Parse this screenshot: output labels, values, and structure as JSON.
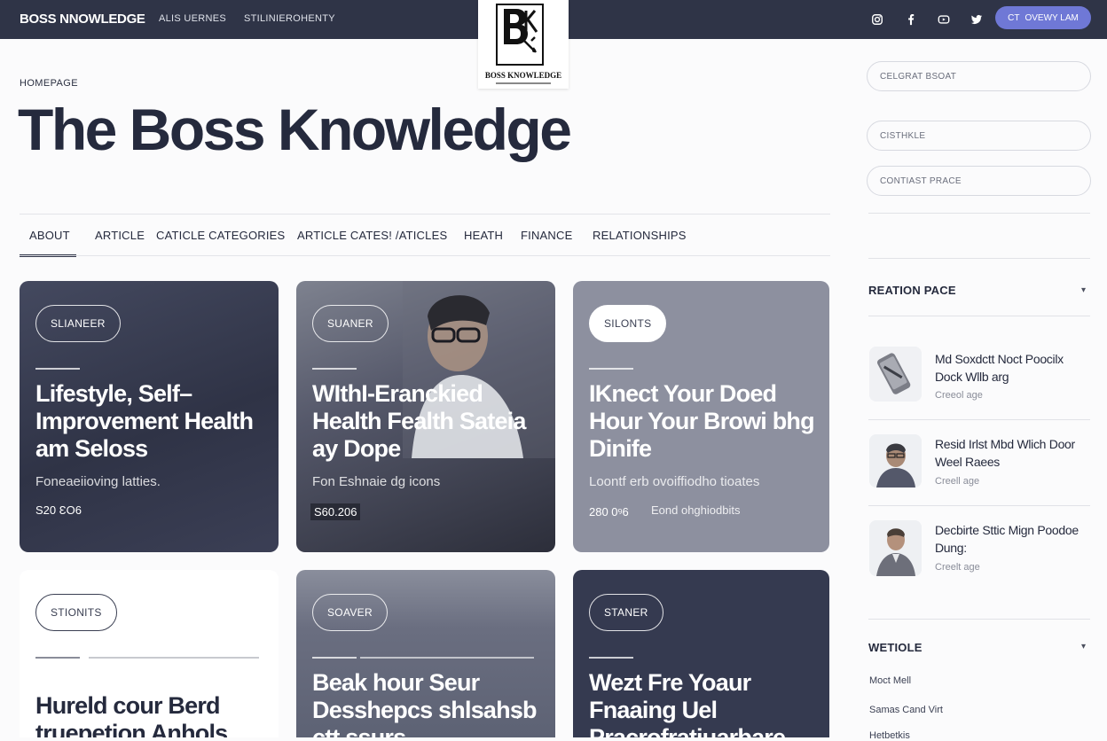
{
  "header": {
    "brand": "BOSS NNOWLEDGE",
    "nav": [
      "ALIS UERNES",
      "STILINIEROHENTY"
    ],
    "social": [
      {
        "icon": "instagram-icon"
      },
      {
        "icon": "facebook-icon"
      },
      {
        "icon": "youtube-icon"
      },
      {
        "icon": "twitter-icon"
      }
    ],
    "cta_label": "OVEWY LAM",
    "cta_prefix": "CT"
  },
  "logo": {
    "letters": "BK",
    "name": "BOSS KNOWLEDGE"
  },
  "page": {
    "breadcrumb": "HOMEPAGE",
    "title": "The Boss Knowledge"
  },
  "tabs": [
    {
      "label": "ABOUT",
      "active": true
    },
    {
      "label": "ARTICLE"
    },
    {
      "label": "CATICLE CATEGORIES"
    },
    {
      "label": "ARTICLE CATES! /ATICLES"
    },
    {
      "label": "HEATH"
    },
    {
      "label": "FINANCE"
    },
    {
      "label": "RELATIONSHIPS"
    }
  ],
  "cards": [
    {
      "tag": "SLIANEER",
      "title": "Lifestyle, Self–Improvement Health am Seloss",
      "desc": "Foneaeiioving latties.",
      "meta": "S20 ƐO6",
      "bg": "#383c50"
    },
    {
      "tag": "SUANER",
      "title": "WIthI-Eranckied Health Fealth Sateia ay Dope",
      "desc": "Fon Eshnaie dg icons",
      "meta": "S60.206",
      "bg": "#4a4c58"
    },
    {
      "tag": "SILONTS",
      "title": "IKnect Your Doed Hour Your Browi bhg Dinife",
      "desc": "Loontf erb ovoiffiodho tioates",
      "meta": "280 0ꝰ6",
      "meta2": "Eond ohghiodbits",
      "bg": "#8d909f"
    },
    {
      "tag": "STIONITS",
      "title": "Hureld cour Berd truepetion Anhols",
      "bg": "#ffffff"
    },
    {
      "tag": "SOAVER",
      "title": "Beak hour Seur Desshepcs shlsahsb ctt ssurs",
      "bg": "#6d7284"
    },
    {
      "tag": "STANER",
      "title": "Wezt Fre Yoaur Fnaaing Uel Pracrofratiuarbare",
      "bg": "#353a50"
    }
  ],
  "sidebar": {
    "inputs": [
      "CELGRAT BSOAT",
      "CISTHKLE",
      "CONTIAST PRACE"
    ],
    "section1": "REATION PACE",
    "posts": [
      {
        "title": "Md Soxdctt Noct Poocilx Dock Wllb arg",
        "sub": "Creeol age",
        "thumb": "phone-thumb"
      },
      {
        "title": "Resid Irlst Mbd Wlich Door Weel Raees",
        "sub": "Creell age",
        "thumb": "man-thumb"
      },
      {
        "title": "Decbirte Sttic Mign Poodoe Dung:",
        "sub": "Creelt age",
        "thumb": "man2-thumb"
      }
    ],
    "section2": "WETIOLE",
    "links": [
      "Moct Mell",
      "Samas Cand Virt",
      "Hetbetkis"
    ]
  },
  "colors": {
    "topbar": "#2f3447",
    "accent": "#6f78d6",
    "text": "#252a3d"
  }
}
